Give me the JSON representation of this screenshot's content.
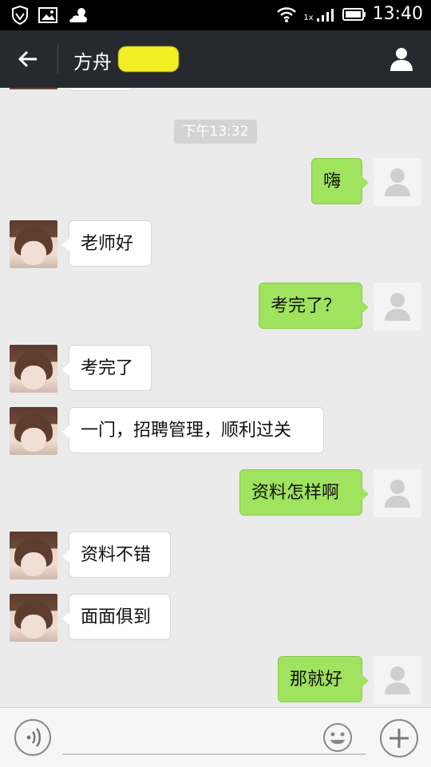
{
  "status_bar": {
    "time": "13:40",
    "network": "1x"
  },
  "header": {
    "contact_name": "方舟"
  },
  "chat": {
    "timestamp": "下午13:32",
    "messages": [
      {
        "side": "right",
        "text": "嗨"
      },
      {
        "side": "left",
        "text": "老师好"
      },
      {
        "side": "right",
        "text": "考完了？"
      },
      {
        "side": "left",
        "text": "考完了"
      },
      {
        "side": "left",
        "text": "一门，招聘管理，顺利过关"
      },
      {
        "side": "right",
        "text": "资料怎样啊"
      },
      {
        "side": "left",
        "text": "资料不错"
      },
      {
        "side": "left",
        "text": "面面俱到"
      },
      {
        "side": "right",
        "text": "那就好"
      }
    ]
  },
  "colors": {
    "sent_bubble": "#9fe35e",
    "received_bubble": "#ffffff",
    "title_bar": "#262a2e",
    "background": "#ebebeb"
  },
  "icons": {
    "shield": "shield-icon",
    "image": "image-icon",
    "weather": "cloud-sun-icon",
    "wifi": "wifi-icon",
    "signal": "signal-icon",
    "battery": "battery-icon",
    "back": "back-arrow-icon",
    "profile": "profile-icon",
    "voice": "voice-icon",
    "emoji": "emoji-icon",
    "plus": "plus-icon"
  }
}
